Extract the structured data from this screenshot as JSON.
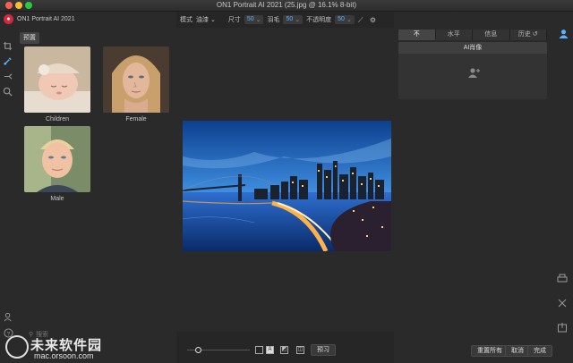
{
  "window": {
    "title": "ON1 Portrait AI 2021 (25.jpg @ 16.1% 8-bit)"
  },
  "app": {
    "name": "ON1 Portrait AI 2021"
  },
  "left_panel": {
    "tab": "预置",
    "presets": [
      {
        "label": "Children"
      },
      {
        "label": "Female"
      },
      {
        "label": "Male"
      }
    ],
    "search_placeholder": "搜索"
  },
  "options_bar": {
    "mode_label": "模式",
    "mode_value": "油漆",
    "size_label": "尺寸",
    "size_value": "50",
    "feather_label": "羽毛",
    "feather_value": "50",
    "opacity_label": "不透明度",
    "opacity_value": "50"
  },
  "right_panel": {
    "tabs": [
      "不",
      "水平",
      "信息",
      "历史"
    ],
    "active_tab": 0,
    "section_title": "AI肖像"
  },
  "bottom_bar": {
    "preview_label": "预习",
    "reset_all_label": "重置所有",
    "cancel_label": "取消",
    "done_label": "完成"
  },
  "watermark": {
    "text": "未来软件园",
    "url": "mac.orsoon.com"
  },
  "colors": {
    "accent": "#5db2ff",
    "brand": "#d6283c",
    "bg": "#262626"
  }
}
